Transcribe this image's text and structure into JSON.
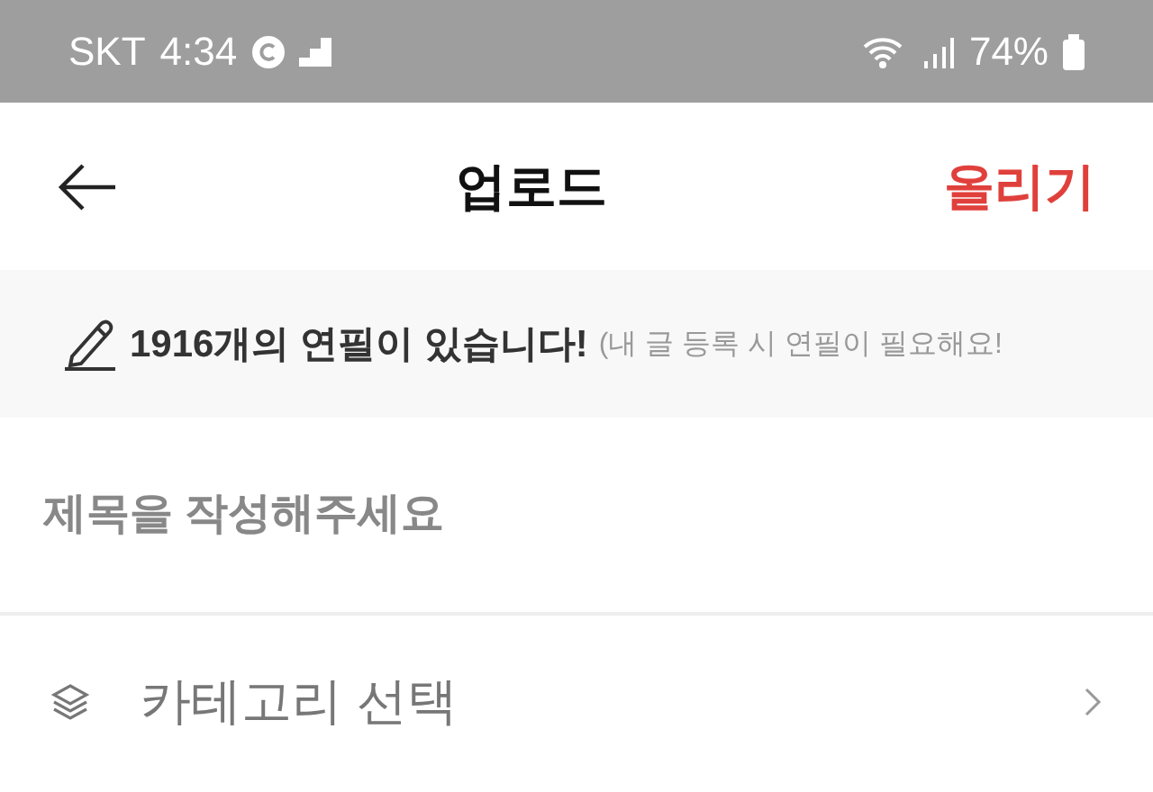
{
  "status_bar": {
    "carrier": "SKT",
    "time": "4:34",
    "battery": "74%"
  },
  "header": {
    "title": "업로드",
    "action": "올리기"
  },
  "notice": {
    "message": "1916개의 연필이 있습니다!",
    "hint": "(내 글 등록 시 연필이 필요해요!"
  },
  "title_field": {
    "placeholder": "제목을 작성해주세요"
  },
  "category": {
    "label": "카테고리 선택"
  }
}
